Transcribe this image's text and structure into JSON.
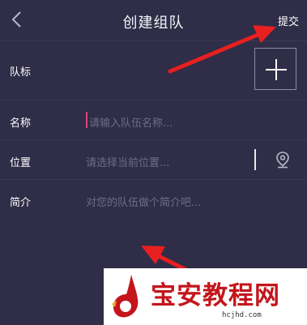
{
  "header": {
    "title": "创建组队",
    "submit_label": "提交",
    "back_icon": "chevron-left-icon"
  },
  "form": {
    "logo": {
      "label": "队标",
      "add_icon": "plus-icon"
    },
    "name": {
      "label": "名称",
      "placeholder": "请输入队伍名称..."
    },
    "location": {
      "label": "位置",
      "placeholder": "请选择当前位置...",
      "icon": "location-pin-icon"
    },
    "intro": {
      "label": "简介",
      "placeholder": "对您的队伍做个简介吧..."
    }
  },
  "colors": {
    "background": "#2f2d47",
    "annotation_arrow": "#e8201f",
    "cursor": "#d6447a",
    "placeholder": "#6f6c8a"
  },
  "watermark": {
    "text": "宝安教程网",
    "url": "hcjhd.com"
  }
}
